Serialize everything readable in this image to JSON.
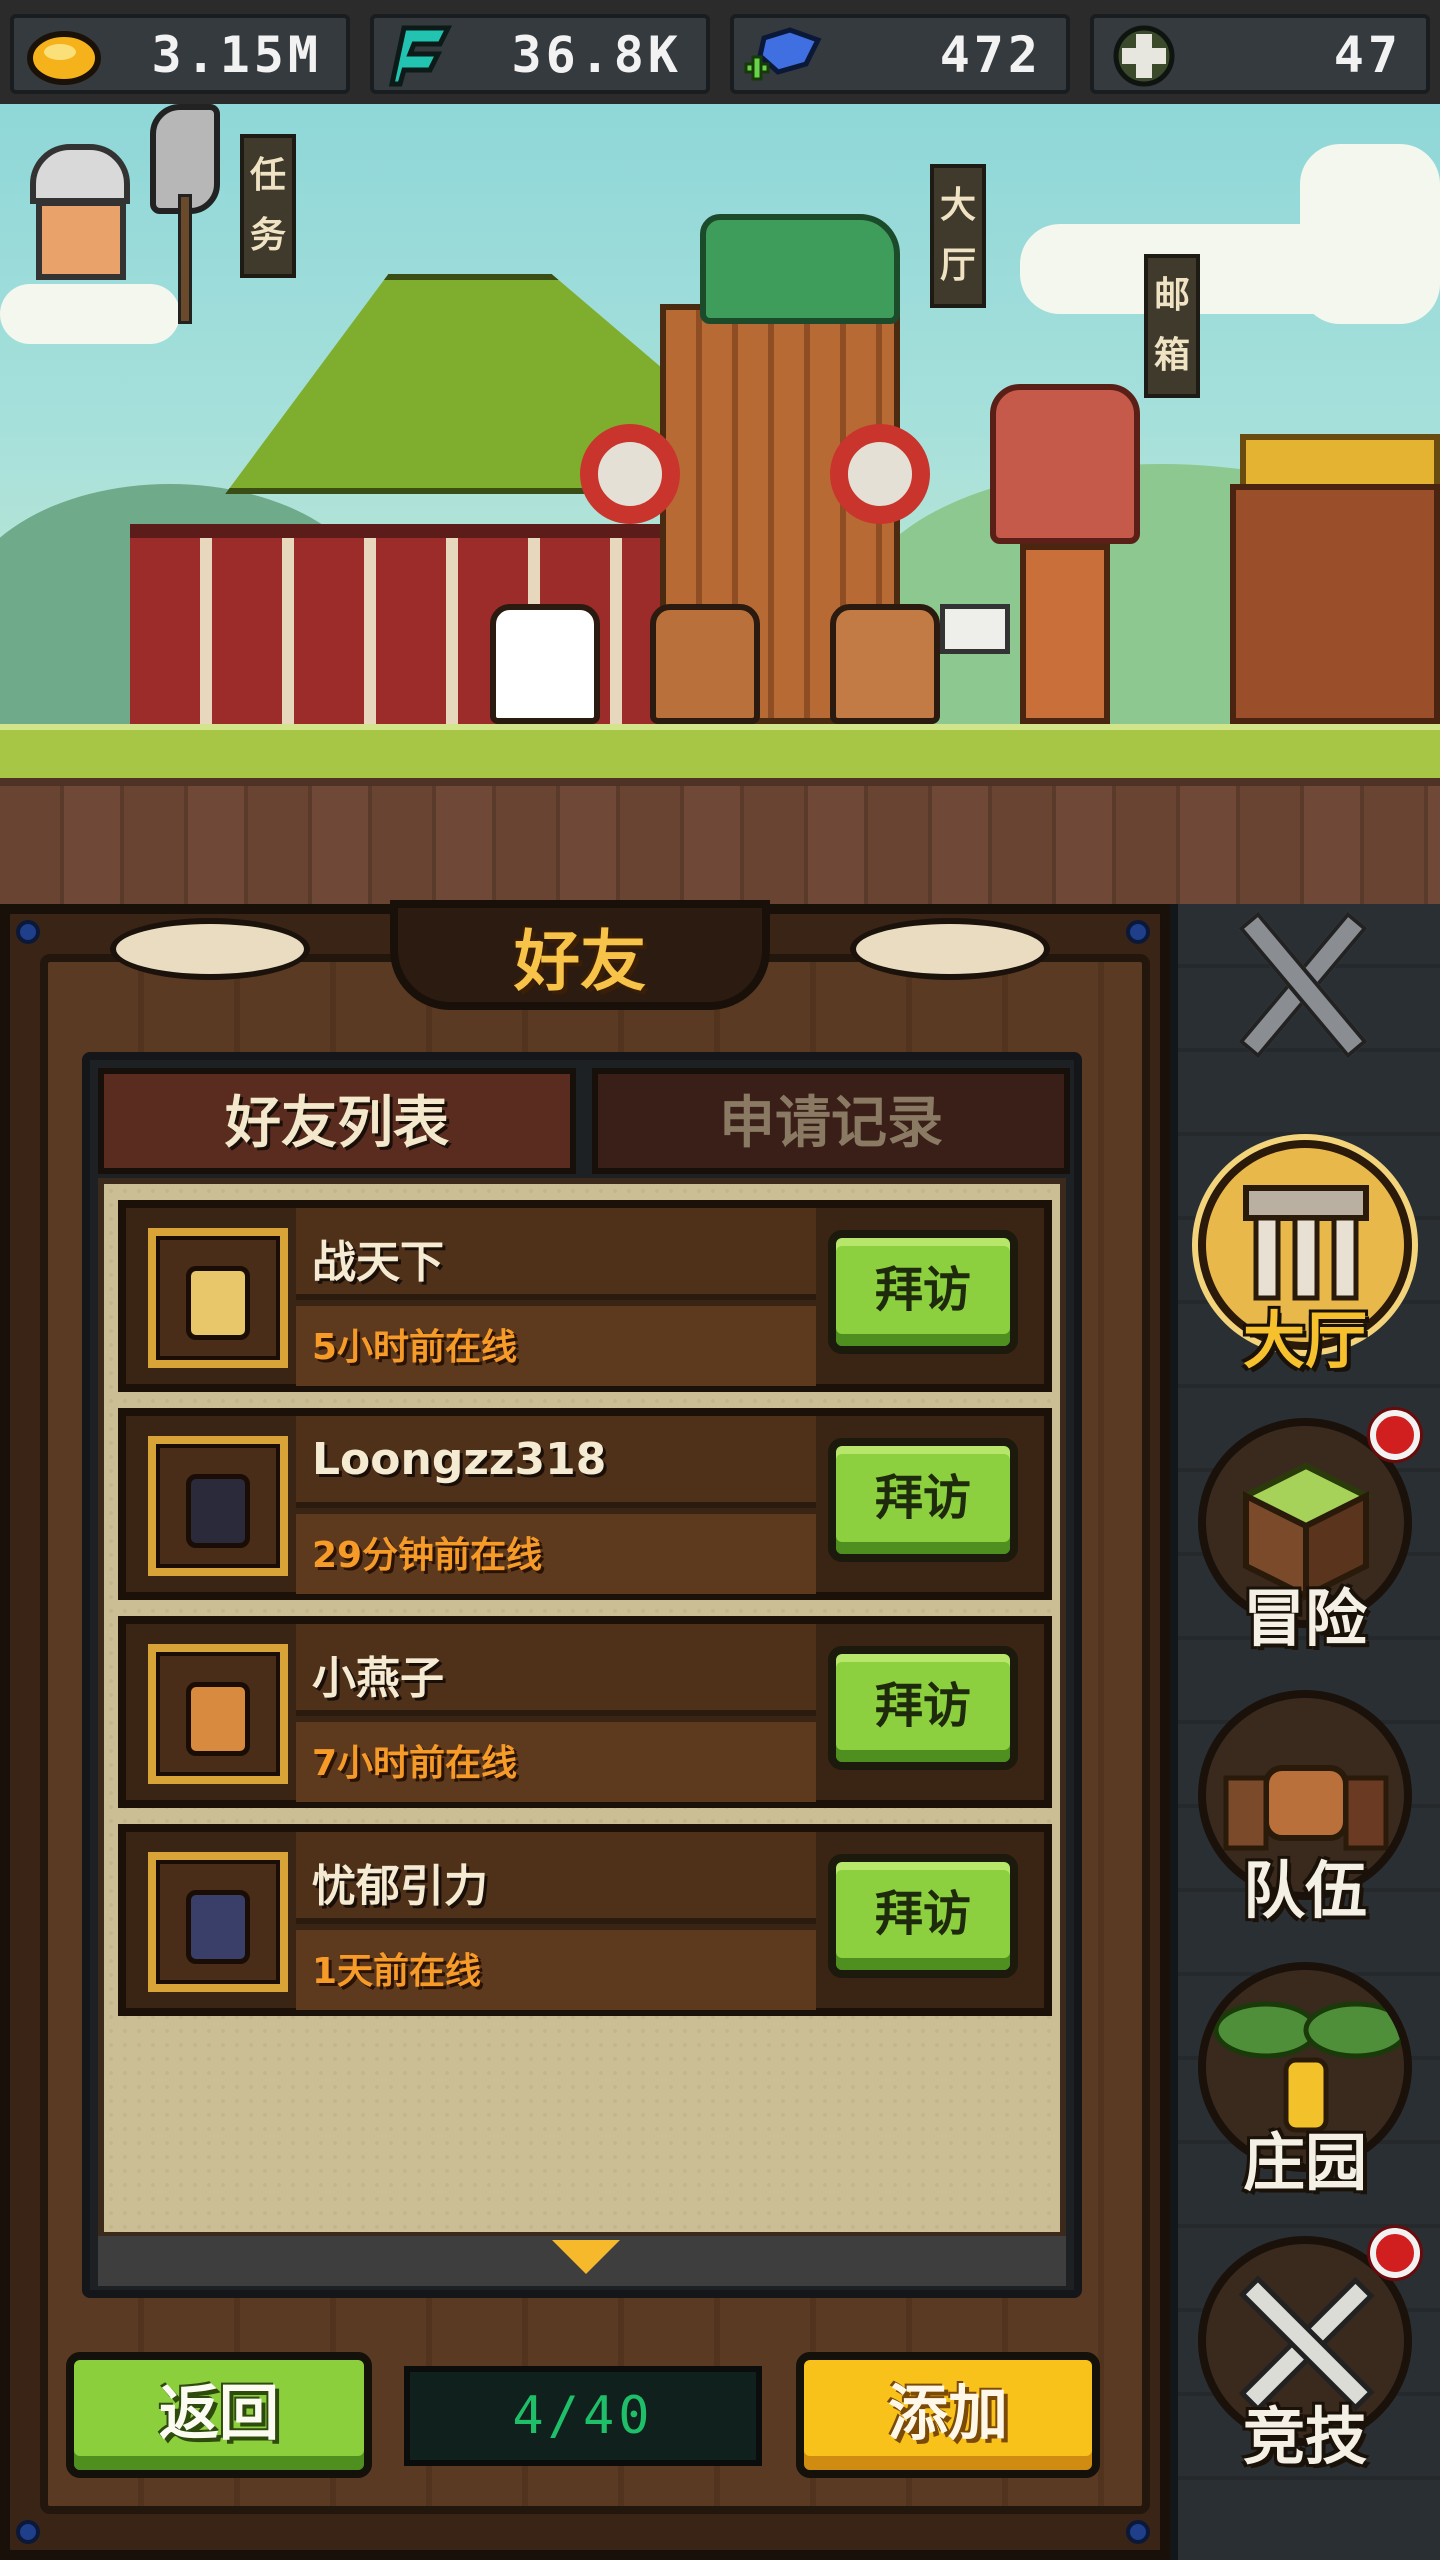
{
  "resources": {
    "gold": {
      "icon": "gold-coin-icon",
      "value": "3.15M"
    },
    "energy": {
      "icon": "energy-crystal-icon",
      "value": "36.8K"
    },
    "gem": {
      "icon": "blue-gem-plus-icon",
      "value": "472"
    },
    "token": {
      "icon": "cross-token-icon",
      "value": "47"
    }
  },
  "scene": {
    "signs": {
      "quest": "任务",
      "hall": "大厅",
      "mailbox": "邮箱"
    }
  },
  "panel": {
    "title": "好友",
    "tabs": [
      {
        "label": "好友列表",
        "active": true
      },
      {
        "label": "申请记录",
        "active": false
      }
    ],
    "friends": [
      {
        "name": "战天下",
        "status": "5小时前在线",
        "visit_label": "拜访"
      },
      {
        "name": "Loongzz318",
        "status": "29分钟前在线",
        "visit_label": "拜访"
      },
      {
        "name": "小燕子",
        "status": "7小时前在线",
        "visit_label": "拜访"
      },
      {
        "name": "忧郁引力",
        "status": "1天前在线",
        "visit_label": "拜访"
      }
    ],
    "footer": {
      "back_label": "返回",
      "count": "4/40",
      "add_label": "添加"
    }
  },
  "sidenav": {
    "items": [
      {
        "label": "大厅",
        "icon": "hall-icon",
        "active": true,
        "badge": false
      },
      {
        "label": "冒险",
        "icon": "adventure-icon",
        "active": false,
        "badge": true
      },
      {
        "label": "队伍",
        "icon": "team-icon",
        "active": false,
        "badge": false
      },
      {
        "label": "庄园",
        "icon": "manor-icon",
        "active": false,
        "badge": false
      },
      {
        "label": "竞技",
        "icon": "arena-icon",
        "active": false,
        "badge": true
      }
    ]
  },
  "colors": {
    "accent_gold": "#f7c348",
    "visit_green": "#8ccf3f",
    "add_yellow": "#f8c21b",
    "status_orange": "#f69a28",
    "badge_red": "#d11e1e"
  }
}
